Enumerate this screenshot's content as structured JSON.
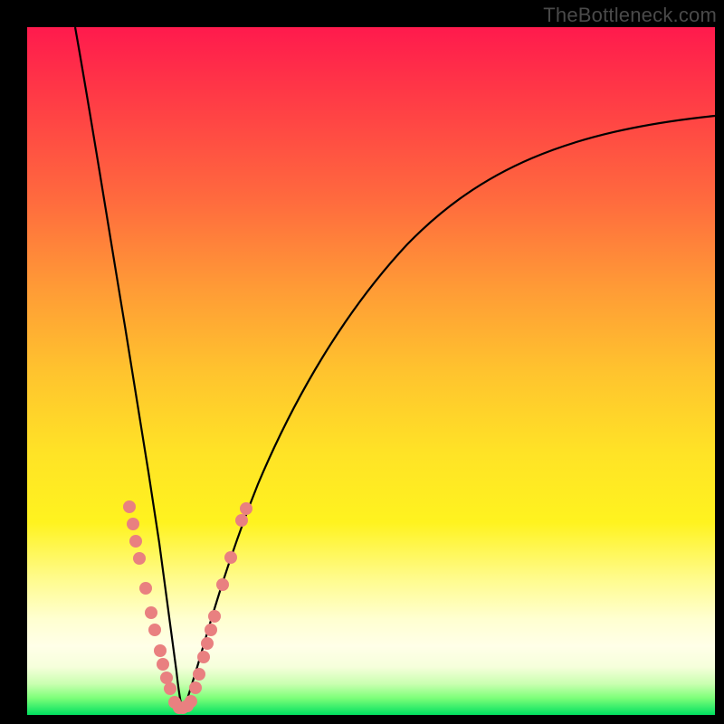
{
  "watermark": "TheBottleneck.com",
  "colors": {
    "frame": "#000000",
    "curve": "#000000",
    "marker": "#e98080",
    "gradient_top": "#ff1a4d",
    "gradient_bottom": "#00e060"
  },
  "chart_data": {
    "type": "line",
    "title": "",
    "xlabel": "",
    "ylabel": "",
    "xlim": [
      0,
      100
    ],
    "ylim": [
      0,
      100
    ],
    "note": "No axis ticks or numeric labels are rendered; values below are pixel-read estimates on a 0–100 normalized scale (x left→right, y bottom→top). The figure shows a V-shaped bottleneck curve with minimum near x≈22, y≈0.",
    "series": [
      {
        "name": "bottleneck-curve-left",
        "x": [
          7,
          8,
          9,
          10,
          11,
          12,
          13,
          14,
          15,
          16,
          17,
          18,
          19,
          20,
          21,
          22
        ],
        "values": [
          100,
          91,
          82,
          74,
          66,
          58,
          50,
          44,
          37,
          31,
          25,
          20,
          14,
          9,
          4,
          0
        ]
      },
      {
        "name": "bottleneck-curve-right",
        "x": [
          22,
          23,
          24,
          25,
          26,
          28,
          30,
          33,
          36,
          40,
          45,
          50,
          55,
          60,
          65,
          70,
          75,
          80,
          85,
          90,
          95,
          100
        ],
        "values": [
          0,
          2,
          5,
          8,
          12,
          18,
          24,
          32,
          39,
          47,
          55,
          61,
          66,
          70,
          74,
          77,
          79,
          81,
          83,
          84.5,
          86,
          87
        ]
      }
    ],
    "markers": {
      "name": "highlight-dots",
      "color": "#e98080",
      "points_left": [
        {
          "x": 14.8,
          "y": 30
        },
        {
          "x": 15.3,
          "y": 27.5
        },
        {
          "x": 15.8,
          "y": 25
        },
        {
          "x": 16.3,
          "y": 22.5
        },
        {
          "x": 17.3,
          "y": 18
        },
        {
          "x": 18.0,
          "y": 14.5
        },
        {
          "x": 18.6,
          "y": 12
        },
        {
          "x": 19.3,
          "y": 9
        },
        {
          "x": 19.8,
          "y": 7
        },
        {
          "x": 20.3,
          "y": 5
        },
        {
          "x": 20.8,
          "y": 3.5
        }
      ],
      "points_bottom": [
        {
          "x": 21.4,
          "y": 1.5
        },
        {
          "x": 22.0,
          "y": 0.8
        },
        {
          "x": 22.6,
          "y": 0.8
        },
        {
          "x": 23.2,
          "y": 1.2
        },
        {
          "x": 23.8,
          "y": 1.8
        }
      ],
      "points_right": [
        {
          "x": 24.5,
          "y": 4
        },
        {
          "x": 25.0,
          "y": 6
        },
        {
          "x": 25.6,
          "y": 8.5
        },
        {
          "x": 26.1,
          "y": 10.5
        },
        {
          "x": 26.6,
          "y": 12.5
        },
        {
          "x": 27.2,
          "y": 14.5
        },
        {
          "x": 28.4,
          "y": 19
        },
        {
          "x": 29.6,
          "y": 23
        },
        {
          "x": 31.2,
          "y": 28.5
        },
        {
          "x": 31.8,
          "y": 30
        }
      ]
    }
  }
}
